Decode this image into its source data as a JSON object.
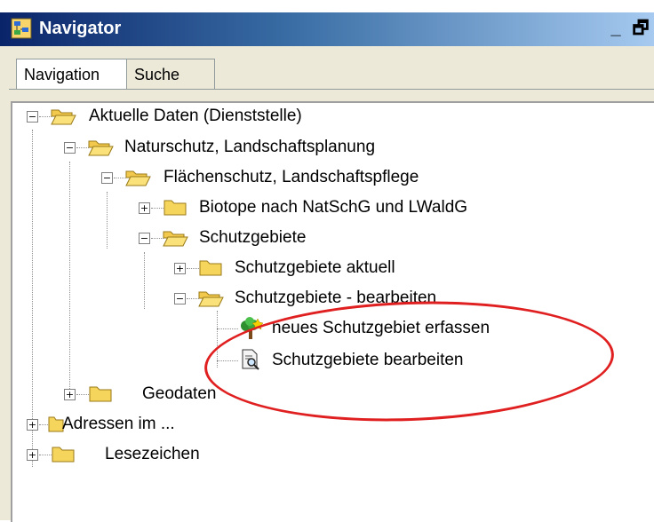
{
  "window": {
    "title": "Navigator",
    "minimize_label": "_",
    "restore_label": "🗗"
  },
  "tabs": [
    {
      "label": "Navigation",
      "active": true
    },
    {
      "label": "Suche",
      "active": false
    }
  ],
  "tree": {
    "items": [
      {
        "label": "Aktuelle Daten (Dienststelle)",
        "expanded": true
      },
      {
        "label": "Naturschutz, Landschaftsplanung",
        "expanded": true
      },
      {
        "label": "Flächenschutz, Landschaftspflege",
        "expanded": true
      },
      {
        "label": "Biotope nach NatSchG und LWaldG",
        "expanded": false
      },
      {
        "label": "Schutzgebiete",
        "expanded": true
      },
      {
        "label": "Schutzgebiete aktuell",
        "expanded": false
      },
      {
        "label": "Schutzgebiete - bearbeiten",
        "expanded": true
      },
      {
        "label": "neues Schutzgebiet erfassen"
      },
      {
        "label": "Schutzgebiete bearbeiten"
      },
      {
        "label": "Geodaten",
        "expanded": false
      },
      {
        "label": "Adressen im ...",
        "expanded": false
      },
      {
        "label": "Lesezeichen",
        "expanded": false
      }
    ]
  },
  "annotation_color": "#e02020"
}
